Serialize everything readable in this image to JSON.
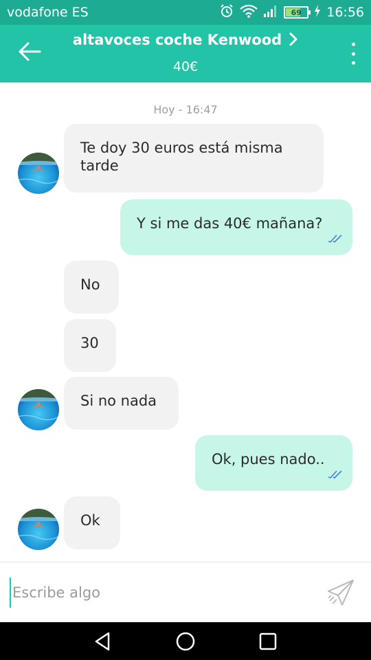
{
  "status_bar": {
    "carrier": "vodafone ES",
    "battery": "69",
    "battery_level": 0.69,
    "time": "16:56",
    "icons": [
      "alarm-icon",
      "wifi-icon",
      "signal-icon",
      "battery-icon",
      "charging-icon"
    ]
  },
  "header": {
    "title": "altavoces coche Kenwood",
    "price": "40€",
    "icons": [
      "back-arrow-icon",
      "chevron-right-icon",
      "more-vert-icon"
    ]
  },
  "chat": {
    "date_label": "Hoy - 16:47",
    "messages": [
      {
        "direction": "in",
        "text": "Te doy 30 euros está misma tarde",
        "avatar": true
      },
      {
        "direction": "out",
        "text": "Y si me das 40€ mañana?",
        "read": true
      },
      {
        "direction": "in",
        "text": "No",
        "avatar": false
      },
      {
        "direction": "in",
        "text": "30",
        "avatar": false
      },
      {
        "direction": "in",
        "text": "Si no nada",
        "avatar": true
      },
      {
        "direction": "out",
        "text": "Ok, pues nado..",
        "read": true
      },
      {
        "direction": "in",
        "text": "Ok",
        "avatar": true
      }
    ]
  },
  "composer": {
    "placeholder": "Escribe algo",
    "value": ""
  },
  "navigation": {
    "icons": [
      "back-triangle-icon",
      "home-circle-icon",
      "recents-square-icon"
    ]
  },
  "colors": {
    "status_bar": "#1dab93",
    "app_bar": "#22c3a6",
    "incoming_bubble": "#f2f2f2",
    "outgoing_bubble": "#c6f6e8",
    "read_check": "#4a7fd6"
  }
}
